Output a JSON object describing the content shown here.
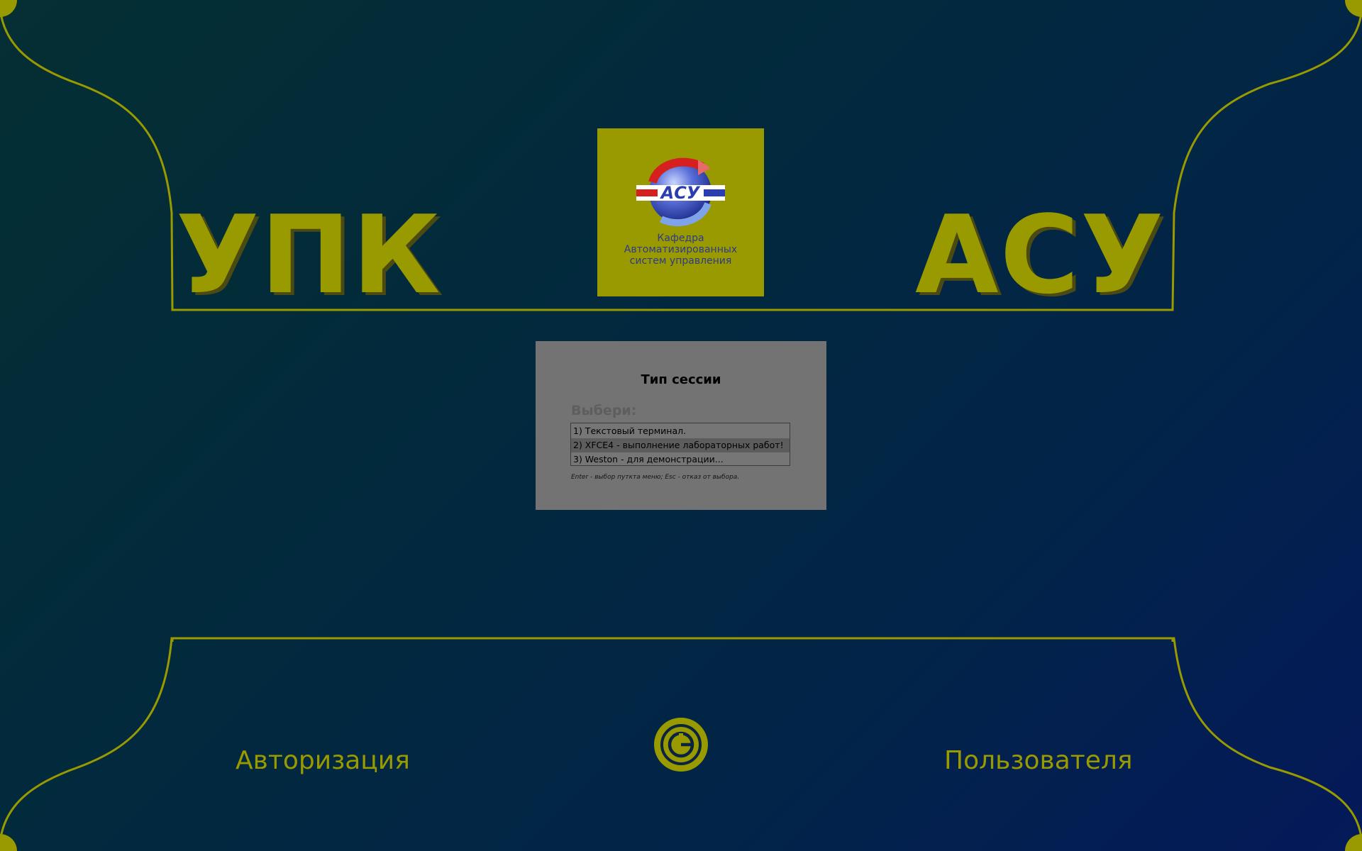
{
  "header": {
    "title_left": "УПК",
    "title_right": "АСУ"
  },
  "logo": {
    "emblem_text": "АСУ",
    "caption_lines": [
      "Кафедра",
      "Автоматизированных",
      "систем управления"
    ]
  },
  "session_dialog": {
    "title": "Тип сессии",
    "prompt": "Выбери:",
    "options": [
      {
        "label": "1) Текстовый терминал."
      },
      {
        "label": "2) XFCE4   - выполнение лабораторных работ!"
      },
      {
        "label": "3) Weston  - для демонстрации..."
      }
    ],
    "selected_index": 1,
    "hint": "Enter - выбор путкта меню; Esc - отказ от выбора."
  },
  "footer": {
    "label_left": "Авторизация",
    "label_right": "Пользователя",
    "power_icon": "power-icon"
  },
  "colors": {
    "accent": "#999900",
    "background_start": "#052f33",
    "background_end": "#04195a",
    "dialog_bg": "#737373",
    "selected_row": "#5d5d5d"
  }
}
